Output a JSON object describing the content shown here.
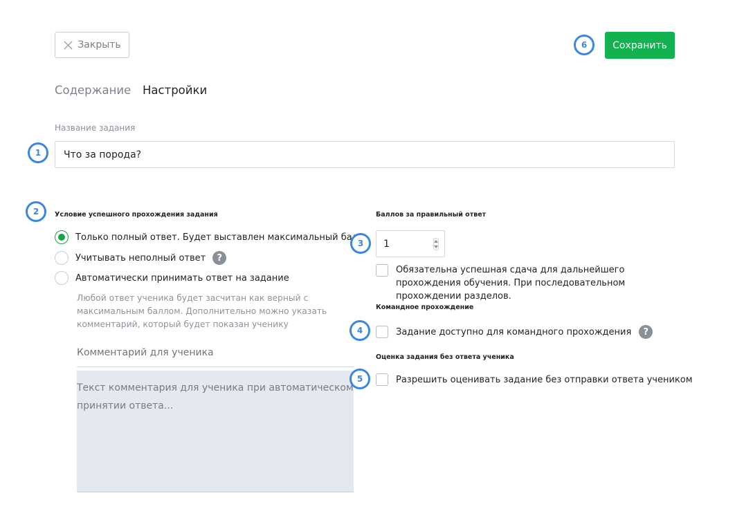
{
  "toolbar": {
    "close_label": "Закрыть",
    "save_label": "Сохранить"
  },
  "tabs": [
    {
      "label": "Содержание",
      "active": false
    },
    {
      "label": "Настройки",
      "active": true
    }
  ],
  "task_name": {
    "label": "Название задания",
    "value": "Что за порода?"
  },
  "pass_condition": {
    "title": "Условие успешного прохождения задания",
    "options": [
      {
        "label": "Только полный ответ. Будет выставлен максимальный балл",
        "checked": true
      },
      {
        "label": "Учитывать неполный ответ",
        "checked": false
      },
      {
        "label": "Автоматически принимать ответ на задание",
        "checked": false
      }
    ],
    "hint": "Любой ответ ученика будет засчитан как верный с максимальным баллом. Дополнительно можно указать комментарий, который будет показан ученику",
    "comment_label": "Комментарий для ученика",
    "comment_placeholder": "Текст комментария для ученика при автоматическом принятии ответа..."
  },
  "score": {
    "title": "Баллов за правильный ответ",
    "value": "1",
    "required_checkbox_label": "Обязательна успешная сдача для дальнейшего прохождения обучения. При последовательном прохождении разделов."
  },
  "team": {
    "title": "Командное прохождение",
    "checkbox_label": "Задание доступно для командного прохождения"
  },
  "grading": {
    "title": "Оценка задания без ответа ученика",
    "checkbox_label": "Разрешить оценивать задание без отправки ответа учеником"
  },
  "annotations": [
    "1",
    "2",
    "3",
    "4",
    "5",
    "6"
  ],
  "colors": {
    "primary": "#12b250",
    "annotation": "#3a86e0",
    "radio_checked": "#16a34a"
  },
  "icons": {
    "close": "close-icon",
    "help": "help-icon",
    "stepper": "stepper-icon"
  }
}
